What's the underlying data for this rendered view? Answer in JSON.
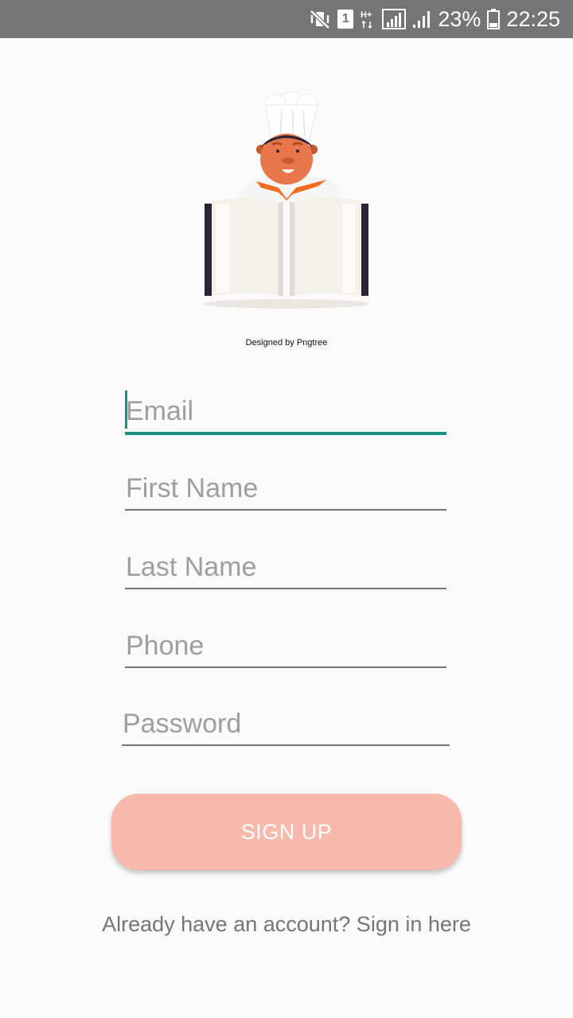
{
  "status_bar": {
    "battery_percent": "23%",
    "time": "22:25",
    "sim_slot": "1",
    "network_type": "H+",
    "icons": [
      "mute-vibrate-icon",
      "sim-1-icon",
      "hplus-data-icon",
      "signal-icon",
      "signal-icon",
      "battery-icon"
    ],
    "background_color": "#757575"
  },
  "header": {
    "illustration": "chef-with-open-book-illustration",
    "credit": "Designed by Pngtree"
  },
  "form": {
    "email_placeholder": "Email",
    "first_name_placeholder": "First Name",
    "last_name_placeholder": "Last Name",
    "phone_placeholder": "Phone",
    "password_placeholder": "Password",
    "focused_field": "Email",
    "accent_color": "#168f84"
  },
  "actions": {
    "signup_label": "SIGN UP",
    "signup_color": "#f7b9ac",
    "signin_link": "Already have an account? Sign in here"
  }
}
